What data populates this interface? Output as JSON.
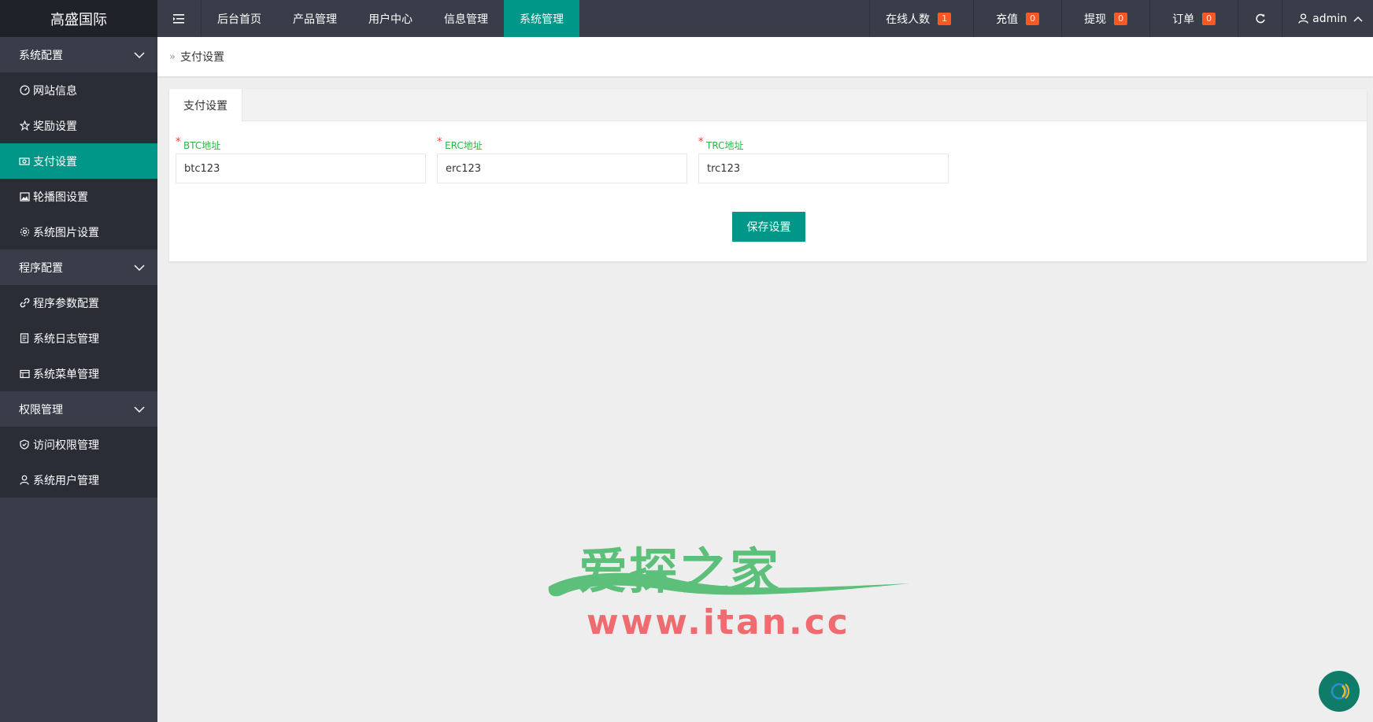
{
  "header": {
    "logo": "高盛国际",
    "nav": [
      {
        "label": "后台首页"
      },
      {
        "label": "产品管理"
      },
      {
        "label": "用户中心"
      },
      {
        "label": "信息管理"
      },
      {
        "label": "系统管理",
        "active": true
      }
    ],
    "stats": [
      {
        "label": "在线人数",
        "count": "1"
      },
      {
        "label": "充值",
        "count": "0"
      },
      {
        "label": "提现",
        "count": "0"
      },
      {
        "label": "订单",
        "count": "0"
      }
    ],
    "user": "admin"
  },
  "sidebar": {
    "groups": [
      {
        "title": "系统配置",
        "items": [
          {
            "label": "网站信息",
            "icon": "dashboard-icon"
          },
          {
            "label": "奖励设置",
            "icon": "star-icon"
          },
          {
            "label": "支付设置",
            "icon": "money-icon",
            "active": true
          },
          {
            "label": "轮播图设置",
            "icon": "image-icon"
          },
          {
            "label": "系统图片设置",
            "icon": "gear-icon"
          }
        ]
      },
      {
        "title": "程序配置",
        "items": [
          {
            "label": "程序参数配置",
            "icon": "link-icon"
          },
          {
            "label": "系统日志管理",
            "icon": "log-icon"
          },
          {
            "label": "系统菜单管理",
            "icon": "menu-icon"
          }
        ]
      },
      {
        "title": "权限管理",
        "items": [
          {
            "label": "访问权限管理",
            "icon": "shield-icon"
          },
          {
            "label": "系统用户管理",
            "icon": "user-icon"
          }
        ]
      }
    ]
  },
  "breadcrumb": "支付设置",
  "tab": "支付设置",
  "form": {
    "fields": [
      {
        "label": "BTC地址",
        "value": "btc123"
      },
      {
        "label": "ERC地址",
        "value": "erc123"
      },
      {
        "label": "TRC地址",
        "value": "trc123"
      }
    ],
    "save_label": "保存设置"
  },
  "watermark": {
    "cn": "爱探之家",
    "url": "www.itan.cc"
  },
  "colors": {
    "primary": "#009688",
    "header": "#393d49",
    "badge": "#ff5722"
  }
}
